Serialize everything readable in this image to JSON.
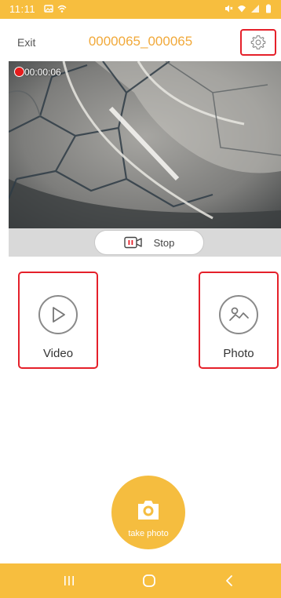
{
  "status_bar": {
    "time": "11:11",
    "left_icons": [
      "image-icon",
      "wifi-hotspot-icon"
    ],
    "right_icons": [
      "mute-icon",
      "wifi-icon",
      "signal-icon",
      "battery-icon"
    ]
  },
  "header": {
    "exit_label": "Exit",
    "title": "0000065_000065",
    "settings_icon": "gear-icon"
  },
  "preview": {
    "recording_time": "00:00:06",
    "stop_label": "Stop",
    "stop_icon": "record-stop-icon"
  },
  "modes": {
    "video_label": "Video",
    "video_icon": "play-icon",
    "photo_label": "Photo",
    "photo_icon": "gallery-icon"
  },
  "shutter": {
    "label": "take photo",
    "icon": "camera-icon"
  },
  "nav_bar": {
    "items": [
      "recents-icon",
      "home-icon",
      "back-icon"
    ]
  },
  "colors": {
    "accent": "#f7be3e",
    "title": "#f1a93a",
    "highlight": "#e5202a",
    "record": "#e51c1c"
  }
}
